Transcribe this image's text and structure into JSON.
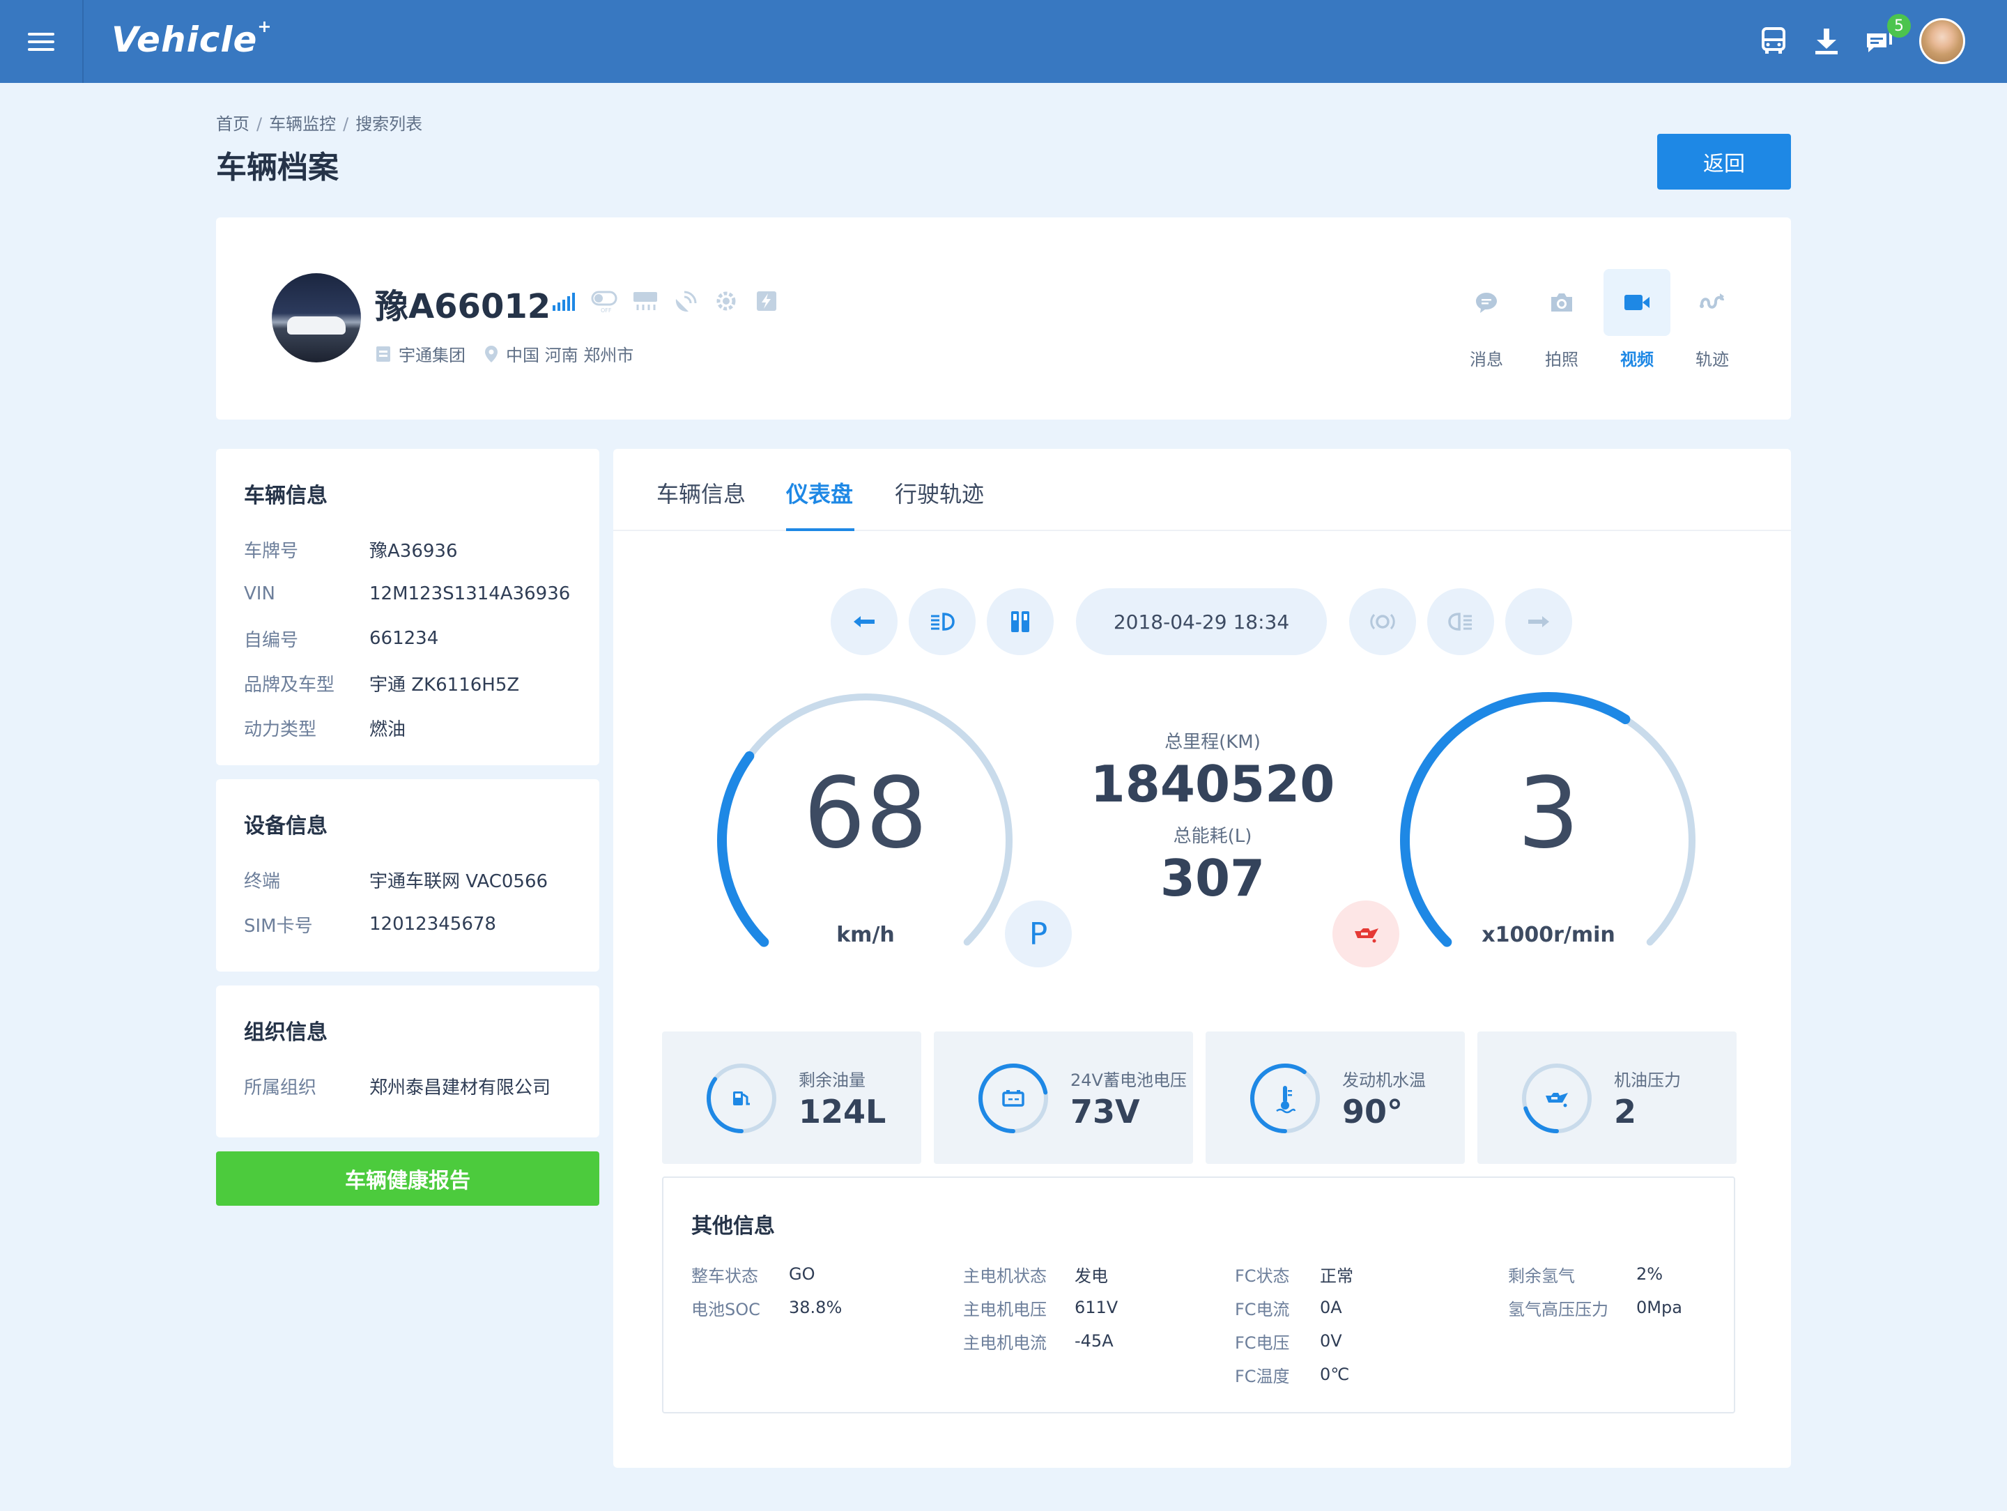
{
  "app": {
    "brand": "Vehicle",
    "brand_mark": "+"
  },
  "topbar": {
    "message_count": "5"
  },
  "breadcrumb": [
    "首页",
    "车辆监控",
    "搜索列表"
  ],
  "page_title": "车辆档案",
  "back_label": "返回",
  "vehicle": {
    "plate": "豫A66012",
    "company": "宇通集团",
    "location": "中国 河南 郑州市"
  },
  "actions": [
    {
      "label": "消息",
      "icon": "chat-bubble-icon"
    },
    {
      "label": "拍照",
      "icon": "camera-icon"
    },
    {
      "label": "视频",
      "icon": "video-camera-icon",
      "active": true
    },
    {
      "label": "轨迹",
      "icon": "route-icon"
    }
  ],
  "vehicle_info": {
    "title": "车辆信息",
    "rows": [
      {
        "k": "车牌号",
        "v": "豫A36936"
      },
      {
        "k": "VIN",
        "v": "12M123S1314A36936"
      },
      {
        "k": "自编号",
        "v": "661234"
      },
      {
        "k": "品牌及车型",
        "v": "宇通 ZK6116H5Z"
      },
      {
        "k": "动力类型",
        "v": "燃油"
      }
    ]
  },
  "device_info": {
    "title": "设备信息",
    "rows": [
      {
        "k": "终端",
        "v": "宇通车联网 VAC0566"
      },
      {
        "k": "SIM卡号",
        "v": "12012345678"
      }
    ]
  },
  "org_info": {
    "title": "组织信息",
    "rows": [
      {
        "k": "所属组织",
        "v": "郑州泰昌建材有限公司"
      }
    ]
  },
  "health_report_label": "车辆健康报告",
  "tabs": [
    {
      "label": "车辆信息"
    },
    {
      "label": "仪表盘",
      "active": true
    },
    {
      "label": "行驶轨迹"
    }
  ],
  "dashboard": {
    "datetime": "2018-04-29 18:34",
    "speed": {
      "value": "68",
      "unit": "km/h",
      "fraction": 0.3
    },
    "rpm": {
      "value": "3",
      "unit": "x1000r/min",
      "fraction": 0.62
    },
    "mileage": {
      "label": "总里程(KM)",
      "value": "1840520"
    },
    "energy": {
      "label": "总能耗(L)",
      "value": "307"
    },
    "gear": "P",
    "stats": [
      {
        "label": "剩余油量",
        "value": "124L",
        "icon": "fuel-pump-icon",
        "fraction": 0.35
      },
      {
        "label": "24V蓄电池电压",
        "value": "73V",
        "icon": "battery-icon",
        "fraction": 0.72
      },
      {
        "label": "发动机水温",
        "value": "90°",
        "icon": "thermometer-icon",
        "fraction": 0.6
      },
      {
        "label": "机油压力",
        "value": "2",
        "icon": "oil-can-icon",
        "fraction": 0.2
      }
    ],
    "accent": "#1e88e5",
    "track": "#c9dbeb"
  },
  "other_info": {
    "title": "其他信息",
    "columns": [
      [
        {
          "k": "整车状态",
          "v": "GO"
        },
        {
          "k": "电池SOC",
          "v": "38.8%"
        }
      ],
      [
        {
          "k": "主电机状态",
          "v": "发电"
        },
        {
          "k": "主电机电压",
          "v": "611V"
        },
        {
          "k": "主电机电流",
          "v": "-45A"
        }
      ],
      [
        {
          "k": "FC状态",
          "v": "正常"
        },
        {
          "k": "FC电流",
          "v": "0A"
        },
        {
          "k": "FC电压",
          "v": "0V"
        },
        {
          "k": "FC温度",
          "v": "0℃"
        }
      ],
      [
        {
          "k": "剩余氢气",
          "v": "2%"
        },
        {
          "k": "氢气高压压力",
          "v": "0Mpa"
        }
      ]
    ]
  }
}
